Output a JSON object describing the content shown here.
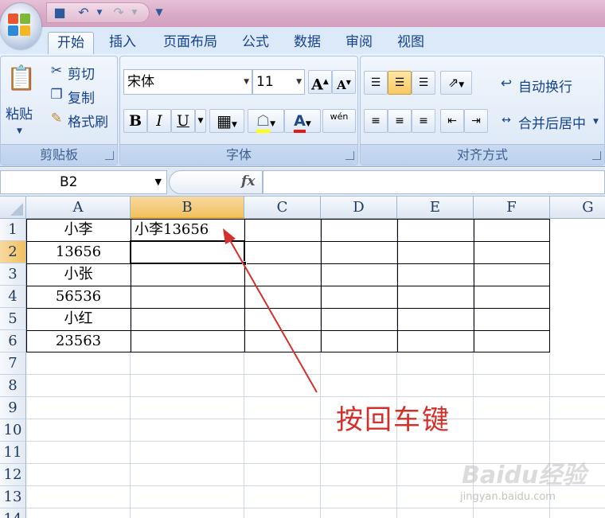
{
  "quick_access": {
    "save_icon": "save-icon",
    "undo_icon": "undo-icon",
    "redo_icon": "redo-icon",
    "customize_icon": "customize-qat-icon"
  },
  "tabs": [
    {
      "label": "开始",
      "active": true
    },
    {
      "label": "插入"
    },
    {
      "label": "页面布局"
    },
    {
      "label": "公式"
    },
    {
      "label": "数据"
    },
    {
      "label": "审阅"
    },
    {
      "label": "视图"
    }
  ],
  "clipboard": {
    "paste_label": "粘贴",
    "cut_label": "剪切",
    "copy_label": "复制",
    "format_painter_label": "格式刷",
    "group_label": "剪贴板"
  },
  "font": {
    "name": "宋体",
    "size": "11",
    "bold_label": "B",
    "italic_label": "I",
    "underline_label": "U",
    "color_label": "A",
    "phonetic_label": "wén",
    "group_label": "字体"
  },
  "alignment": {
    "wrap_text_label": "自动换行",
    "merge_center_label": "合并后居中",
    "group_label": "对齐方式"
  },
  "formula_bar": {
    "name_box": "B2",
    "fx_label": "fx",
    "formula": ""
  },
  "sheet": {
    "columns": [
      "A",
      "B",
      "C",
      "D",
      "E",
      "F",
      "G"
    ],
    "rows": [
      "1",
      "2",
      "3",
      "4",
      "5",
      "6",
      "7",
      "8",
      "9",
      "10",
      "11",
      "12",
      "13",
      "14"
    ],
    "selected_cell": "B2",
    "cells": {
      "A1": "小李",
      "B1": "小李13656",
      "A2": "13656",
      "A3": "小张",
      "A4": "56536",
      "A5": "小红",
      "A6": "23563"
    }
  },
  "annotation": {
    "text": "按回车键",
    "color": "#d2302a"
  },
  "watermark": {
    "text": "Baidu经验",
    "url_text": "jingyan.baidu.com"
  }
}
